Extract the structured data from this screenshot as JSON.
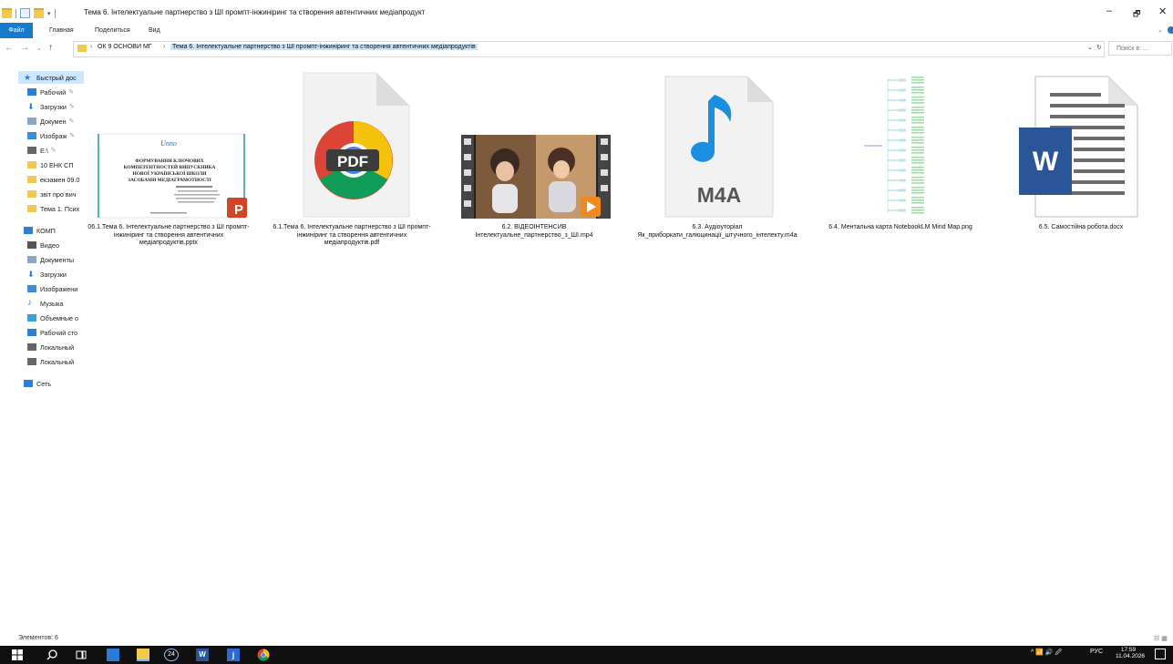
{
  "window": {
    "title": "Тема 6. Інтелектуальне партнерство з ШІ промпт-інжиніринг та створення автентичних медіапродукт",
    "controls": {
      "minimize": "–",
      "maximize": "🗗",
      "close": "✕"
    }
  },
  "ribbon": {
    "file": "Файл",
    "tabs": [
      "Главная",
      "Поделиться",
      "Вид"
    ]
  },
  "address": {
    "crumbs": [
      "ОК 9 ОСНОВИ МГ",
      "Тема 6. Інтелектуальне партнерство з ШІ промпт-інжиніринг та створення автентичних медіапродуктів"
    ],
    "search_placeholder": "Поиск в: ..."
  },
  "navpane": {
    "items": [
      {
        "label": "Быстрый дос",
        "icon": "star-icon",
        "color": "#2b7fd6"
      },
      {
        "label": "Рабочий",
        "icon": "desktop-icon",
        "color": "#2b7fd6",
        "pinned": true
      },
      {
        "label": "Загрузки",
        "icon": "download-icon",
        "color": "#2b7fd6",
        "pinned": true
      },
      {
        "label": "Докумен",
        "icon": "documents-icon",
        "color": "#8aa6c8",
        "pinned": true
      },
      {
        "label": "Изображ",
        "icon": "pictures-icon",
        "color": "#3a8fd8",
        "pinned": true
      },
      {
        "label": "E:\\",
        "icon": "drive-icon",
        "color": "#666",
        "pinned": true
      },
      {
        "label": "10 ЕНК СП",
        "icon": "folder-icon",
        "color": "#f3c94c"
      },
      {
        "label": "екзамен 09.0",
        "icon": "folder-icon",
        "color": "#f3c94c"
      },
      {
        "label": "звіт про вич",
        "icon": "folder-icon",
        "color": "#f3c94c"
      },
      {
        "label": "Тема 1. Псих",
        "icon": "folder-icon",
        "color": "#f3c94c"
      },
      {
        "label": "КОМП",
        "icon": "computer-icon",
        "color": "#2b7fd6"
      },
      {
        "label": "Видео",
        "icon": "video-icon",
        "color": "#555"
      },
      {
        "label": "Документы",
        "icon": "documents-icon",
        "color": "#8aa6c8"
      },
      {
        "label": "Загрузки",
        "icon": "download-icon",
        "color": "#2b7fd6"
      },
      {
        "label": "Изображени",
        "icon": "pictures-icon",
        "color": "#3a8fd8"
      },
      {
        "label": "Музыка",
        "icon": "music-icon",
        "color": "#2b7fd6"
      },
      {
        "label": "Объемные о",
        "icon": "3d-objects-icon",
        "color": "#3aa0e0"
      },
      {
        "label": "Рабочий сто",
        "icon": "desktop-icon",
        "color": "#2b7fd6"
      },
      {
        "label": "Локальный",
        "icon": "drive-icon",
        "color": "#666"
      },
      {
        "label": "Локальный",
        "icon": "drive-icon",
        "color": "#666"
      },
      {
        "label": "Сеть",
        "icon": "network-icon",
        "color": "#2b7fd6"
      }
    ]
  },
  "files": [
    {
      "name": "06.1.Тема 6. Інтелектуальне партнерство з ШІ промпт-інжиніринг та створення автентичних медіапродуктів.pptx",
      "icon": "pptx-thumbnail",
      "thumb_text": {
        "logo": "Unno",
        "title": "ФОРМУВАННЯ КЛЮЧОВИХ КОМПЕТЕНТНОСТЕЙ ВИПУСКНИКА НОВОЇ УКРАЇНСЬКОЇ ШКОЛИ ЗАСОБАМИ МЕДІАГРАМОТНОСТІ"
      }
    },
    {
      "name": "6.1.Тема 6. Інтелектуальне партнерство з ШІ промпт-інжиніринг та створення автентичних медіапродуктів.pdf",
      "icon": "pdf-icon",
      "thumb_text": {
        "label": "PDF"
      }
    },
    {
      "name": "6.2. ВІДЕОІНТЕНСИВ Інтелектуальне_партнерство_з_ШІ.mp4",
      "icon": "video-thumbnail"
    },
    {
      "name": "6.3. Аудіоуторіал Як_приборкати_галюцинації_штучного_інтелекту.m4a",
      "icon": "m4a-icon",
      "thumb_text": {
        "label": "M4A"
      }
    },
    {
      "name": "6.4. Ментальна карта NotebookLM Mind Map.png",
      "icon": "mindmap-thumbnail"
    },
    {
      "name": "6.5. Самостійна робота.docx",
      "icon": "word-icon",
      "thumb_text": {
        "label": "W"
      }
    }
  ],
  "status": {
    "items_count": "Элементов: 6"
  },
  "taskbar": {
    "badge": "24",
    "tray": {
      "lang": "РУС",
      "time": "17:59",
      "date": "11.04.2026"
    }
  },
  "colors": {
    "accent": "#1979ca",
    "selection": "#cce8ff",
    "taskbar": "#101010"
  }
}
